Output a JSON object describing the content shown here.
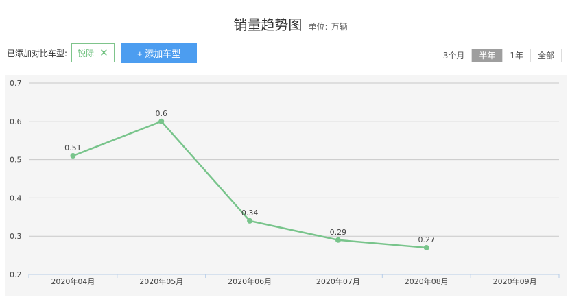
{
  "header": {
    "title": "销量趋势图",
    "unit_label": "单位:",
    "unit_value": "万辆"
  },
  "compare": {
    "label": "已添加对比车型:",
    "tag": "锐际",
    "add_button": "+ 添加车型"
  },
  "range_tabs": [
    {
      "label": "3个月",
      "active": false
    },
    {
      "label": "半年",
      "active": true
    },
    {
      "label": "1年",
      "active": false
    },
    {
      "label": "全部",
      "active": false
    }
  ],
  "colors": {
    "series": "#78c48b",
    "add_button": "#4c9df0",
    "active_tab": "#9e9e9e"
  },
  "icons": {
    "remove_tag": "close-icon"
  },
  "chart_data": {
    "type": "line",
    "categories": [
      "2020年04月",
      "2020年05月",
      "2020年06月",
      "2020年07月",
      "2020年08月",
      "2020年09月"
    ],
    "series": [
      {
        "values": [
          0.51,
          0.6,
          0.34,
          0.29,
          0.27,
          null
        ]
      }
    ],
    "yticks": [
      "0.2",
      "0.3",
      "0.4",
      "0.5",
      "0.6",
      "0.7"
    ],
    "data_labels": [
      "0.51",
      "0.6",
      "0.34",
      "0.29",
      "0.27"
    ],
    "ylim": [
      0.2,
      0.7
    ],
    "grid": true
  }
}
